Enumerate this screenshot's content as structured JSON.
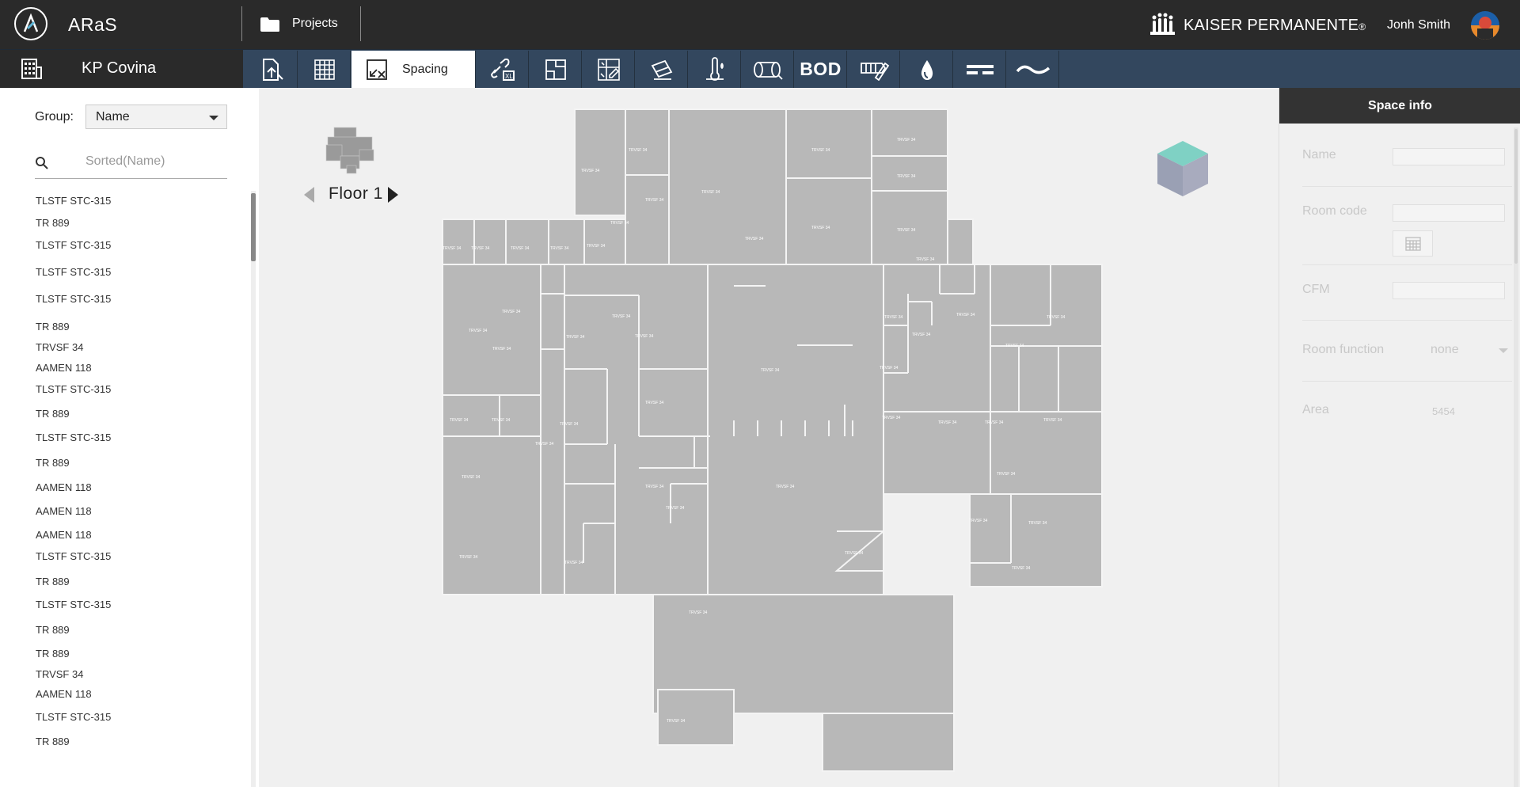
{
  "app": {
    "name": "ARaS",
    "brand": "KAISER PERMANENTE",
    "brand_mark": "®"
  },
  "header": {
    "projects_label": "Projects",
    "user_name": "Jonh Smith"
  },
  "project": {
    "name": "KP Covina"
  },
  "toolbar": {
    "items": [
      {
        "icon": "export-document-icon",
        "label": ""
      },
      {
        "icon": "grid-table-icon",
        "label": ""
      },
      {
        "icon": "spacing-icon",
        "label": "Spacing",
        "active": true
      },
      {
        "icon": "link-xl-icon",
        "label": ""
      },
      {
        "icon": "room-layout-icon",
        "label": ""
      },
      {
        "icon": "layers-edit-icon",
        "label": ""
      },
      {
        "icon": "paint-edit-icon",
        "label": ""
      },
      {
        "icon": "thermometer-drop-icon",
        "label": ""
      },
      {
        "icon": "duct-icon",
        "label": ""
      },
      {
        "icon": "bod-text",
        "label": "BOD"
      },
      {
        "icon": "pencil-tags-icon",
        "label": ""
      },
      {
        "icon": "water-drop-icon",
        "label": ""
      },
      {
        "icon": "dashes-icon",
        "label": ""
      },
      {
        "icon": "wave-icon",
        "label": ""
      }
    ]
  },
  "left_panel": {
    "group_label": "Group:",
    "group_value": "Name",
    "search_placeholder": "Sorted(Name)",
    "items": [
      "TLSTF STC-315",
      "TR 889",
      "TLSTF STC-315",
      "TLSTF STC-315",
      "TLSTF STC-315",
      "TR 889",
      "TRVSF 34",
      "AAMEN 118",
      "TLSTF STC-315",
      "TR 889",
      "TLSTF STC-315",
      "TR 889",
      "AAMEN 118",
      "AAMEN 118",
      "AAMEN 118",
      "TLSTF STC-315",
      "TR 889",
      "TLSTF STC-315",
      "TR 889",
      "TR 889",
      "TRVSF 34",
      "AAMEN 118",
      "TLSTF STC-315",
      "TR 889"
    ]
  },
  "canvas": {
    "floor_label": "Floor 1",
    "room_tag": "TRVSF 34"
  },
  "right_panel": {
    "title": "Space info",
    "name_label": "Name",
    "room_code_label": "Room code",
    "cfm_label": "CFM",
    "room_function_label": "Room function",
    "room_function_value": "none",
    "area_label": "Area",
    "area_value": "5454"
  },
  "colors": {
    "topbar": "#2a2a2a",
    "toolbar": "#33475e",
    "room_fill": "#b8b8b8",
    "accent": "#7fd1c4"
  }
}
